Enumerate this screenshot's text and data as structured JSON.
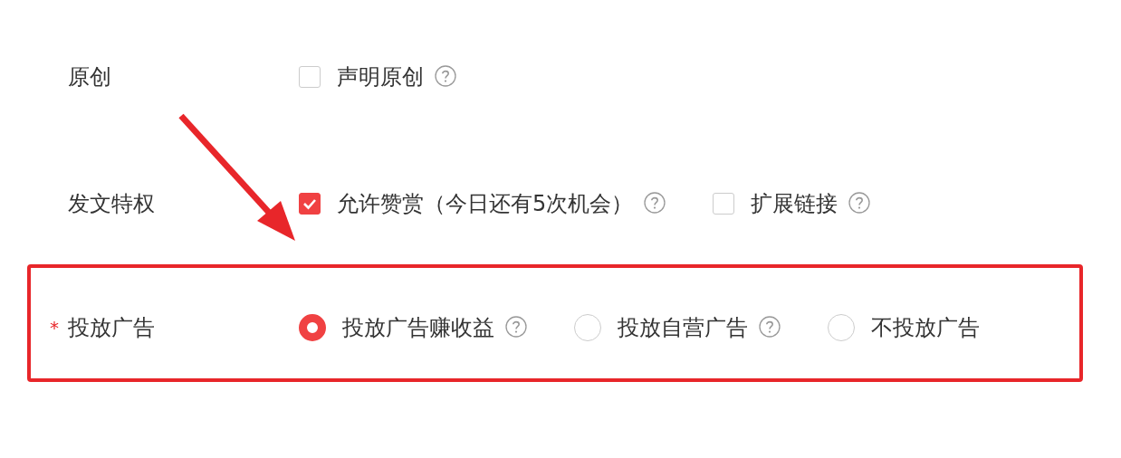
{
  "rows": [
    {
      "label": "原创",
      "highlighted": false,
      "options": [
        {
          "kind": "checkbox",
          "label": "声明原创",
          "checked": false,
          "help": true
        }
      ]
    },
    {
      "label": "发文特权",
      "highlighted": false,
      "options": [
        {
          "kind": "checkbox",
          "label": "允许赞赏（今日还有5次机会）",
          "checked": true,
          "help": true
        },
        {
          "kind": "checkbox",
          "label": "扩展链接",
          "checked": false,
          "help": true
        }
      ]
    },
    {
      "label": "投放广告",
      "required_mark": "*",
      "highlighted": true,
      "options": [
        {
          "kind": "radio",
          "label": "投放广告赚收益",
          "selected": true,
          "help": true
        },
        {
          "kind": "radio",
          "label": "投放自营广告",
          "selected": false,
          "help": true
        },
        {
          "kind": "radio",
          "label": "不投放广告",
          "selected": false,
          "help": false
        }
      ]
    }
  ],
  "pointer_arrow": true
}
